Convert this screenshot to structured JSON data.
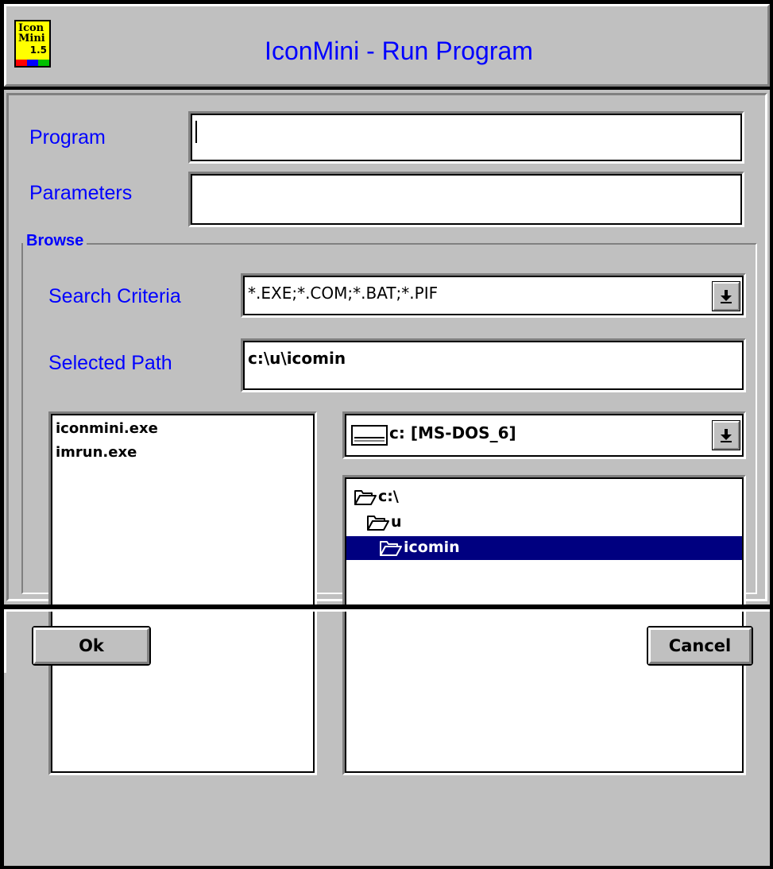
{
  "window": {
    "title": "IconMini - Run Program",
    "app_icon": {
      "name": "iconmini-logo-icon",
      "line1": "Icon",
      "line2": "Mini",
      "version": "1.5",
      "bar_colors": [
        "#ff0000",
        "#0000ff",
        "#00c000"
      ]
    }
  },
  "form": {
    "program_label": "Program",
    "program_value": "",
    "parameters_label": "Parameters",
    "parameters_value": ""
  },
  "browse": {
    "group_label": "Browse",
    "search_criteria_label": "Search Criteria",
    "search_criteria_value": "*.EXE;*.COM;*.BAT;*.PIF",
    "selected_path_label": "Selected Path",
    "selected_path_value": "c:\\u\\icomin",
    "files": [
      "iconmini.exe",
      "imrun.exe"
    ],
    "drive": {
      "icon": "drive-icon",
      "value": "c: [MS-DOS_6]"
    },
    "directories": [
      {
        "name": "c:\\",
        "icon": "open-folder-icon",
        "selected": false
      },
      {
        "name": "u",
        "icon": "open-folder-icon",
        "selected": false
      },
      {
        "name": "icomin",
        "icon": "open-folder-icon",
        "selected": true
      }
    ]
  },
  "buttons": {
    "ok_label": "Ok",
    "cancel_label": "Cancel"
  },
  "colors": {
    "label_blue": "#0000ff",
    "selection": "#000080",
    "face": "#c0c0c0"
  }
}
